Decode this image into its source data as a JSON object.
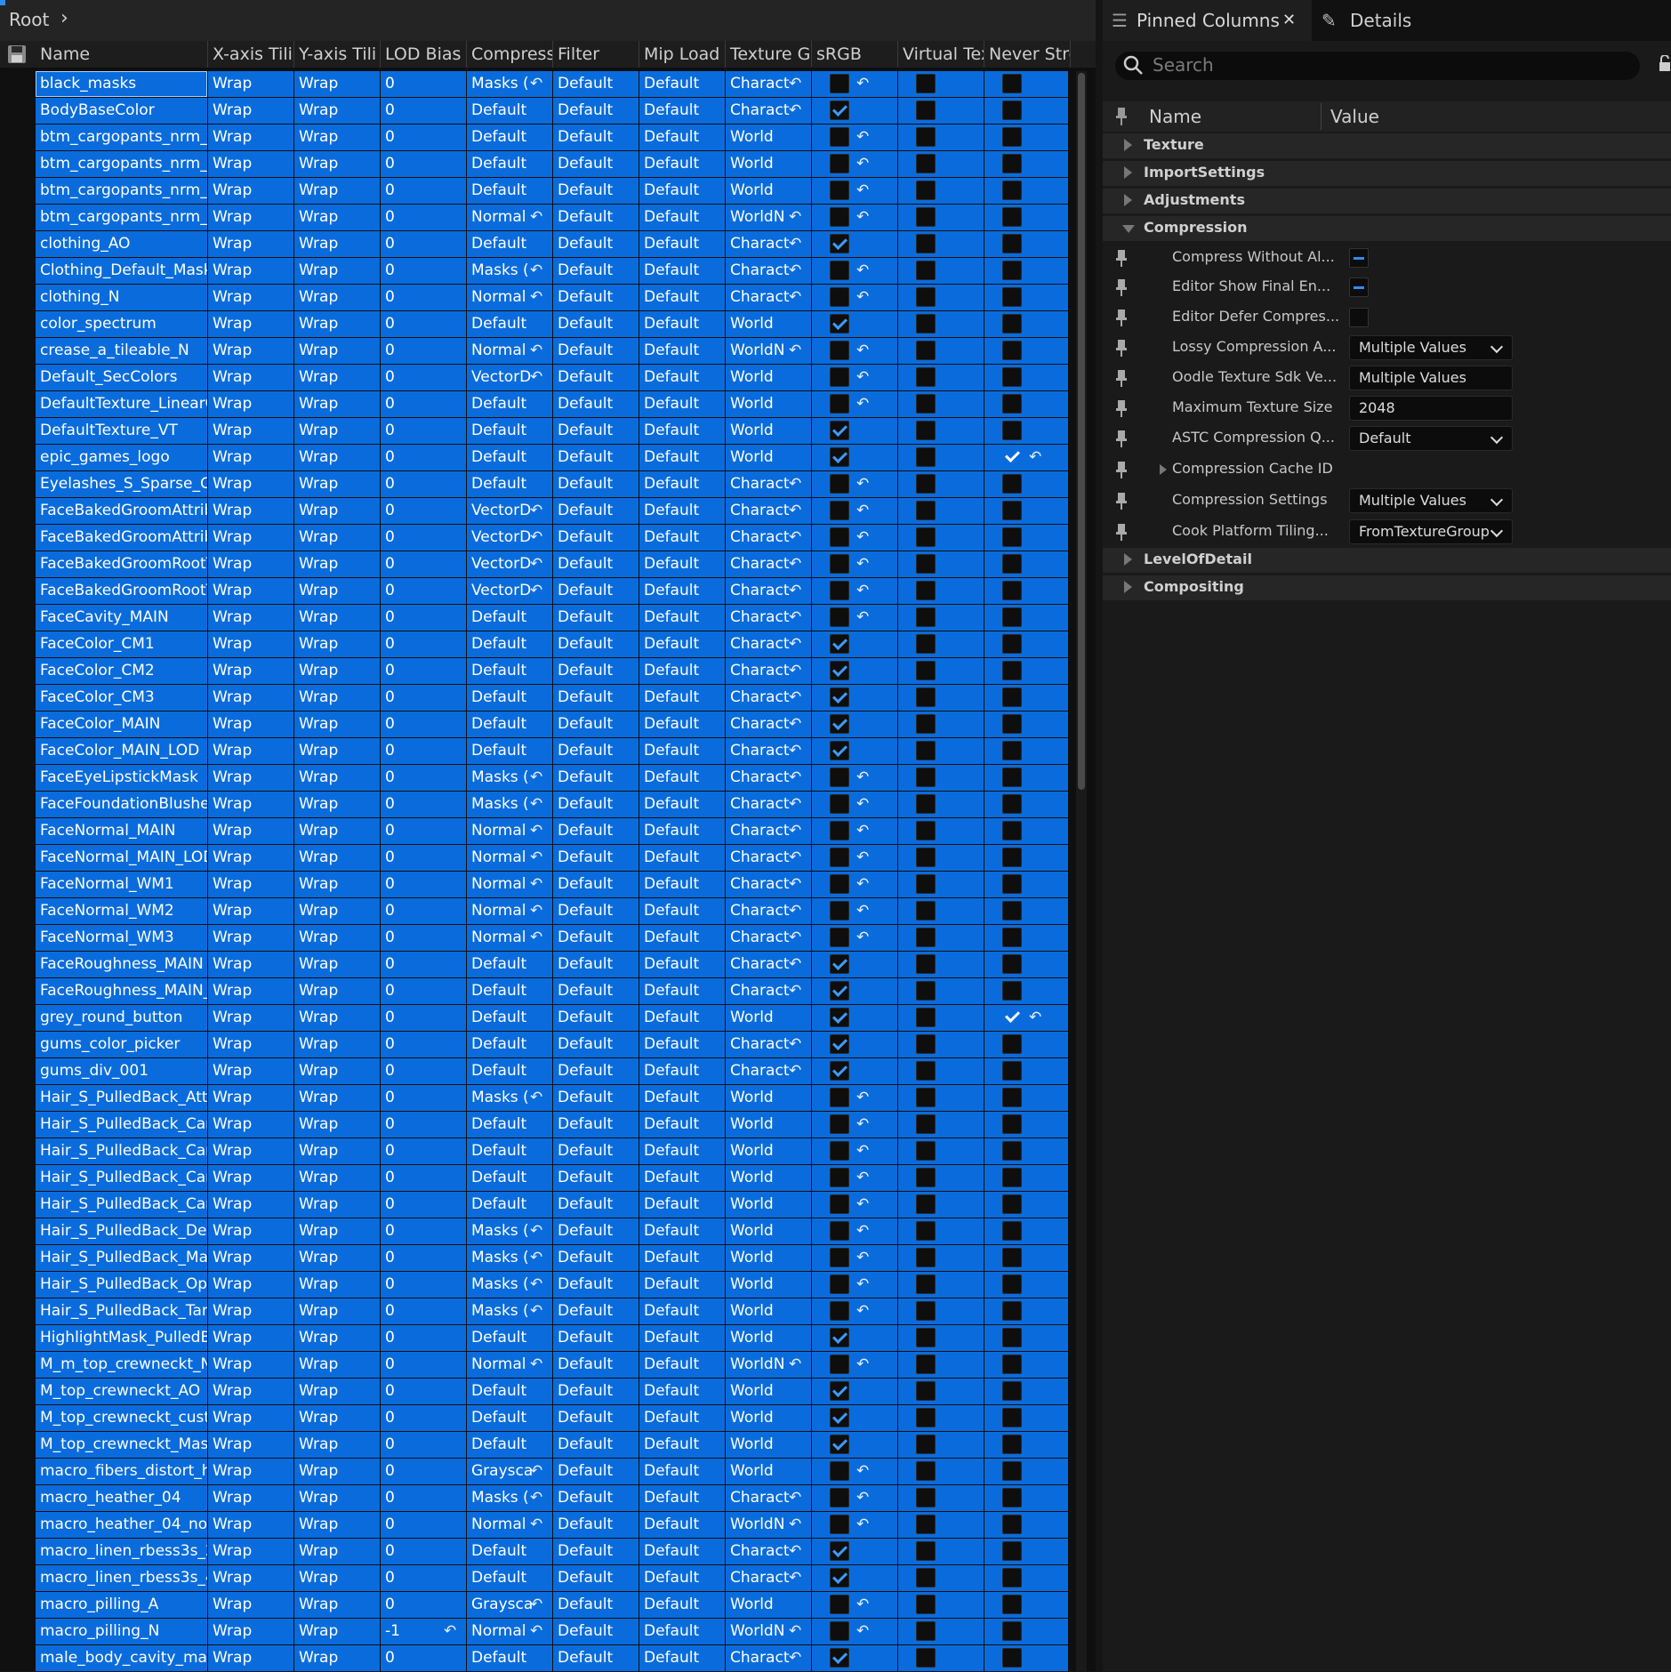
{
  "breadcrumb": {
    "root": "Root"
  },
  "columns": [
    "Name",
    "X-axis Tili",
    "Y-axis Tili",
    "LOD Bias",
    "Compress",
    "Filter",
    "Mip Load (",
    "Texture Gr",
    "sRGB",
    "Virtual Tex",
    "Never Stre"
  ],
  "rows": [
    [
      "black_masks",
      "Wrap",
      "Wrap",
      "0",
      "Masks (",
      "Default",
      "Default",
      "Charact",
      0,
      1,
      1,
      0,
      0
    ],
    [
      "BodyBaseColor",
      "Wrap",
      "Wrap",
      "0",
      "Default",
      "Default",
      "Default",
      "Charact",
      1,
      0,
      1,
      0,
      0
    ],
    [
      "btm_cargopants_nrm_A",
      "Wrap",
      "Wrap",
      "0",
      "Default",
      "Default",
      "Default",
      "World",
      0,
      1,
      0,
      0,
      0
    ],
    [
      "btm_cargopants_nrm_c",
      "Wrap",
      "Wrap",
      "0",
      "Default",
      "Default",
      "Default",
      "World",
      0,
      1,
      0,
      0,
      0
    ],
    [
      "btm_cargopants_nrm_N",
      "Wrap",
      "Wrap",
      "0",
      "Default",
      "Default",
      "Default",
      "World",
      0,
      1,
      0,
      0,
      0
    ],
    [
      "btm_cargopants_nrm_N",
      "Wrap",
      "Wrap",
      "0",
      "Normal",
      "Default",
      "Default",
      "WorldN",
      0,
      1,
      1,
      0,
      0
    ],
    [
      "clothing_AO",
      "Wrap",
      "Wrap",
      "0",
      "Default",
      "Default",
      "Default",
      "Charact",
      1,
      0,
      1,
      0,
      0
    ],
    [
      "Clothing_Default_Mask",
      "Wrap",
      "Wrap",
      "0",
      "Masks (",
      "Default",
      "Default",
      "Charact",
      0,
      1,
      1,
      0,
      0
    ],
    [
      "clothing_N",
      "Wrap",
      "Wrap",
      "0",
      "Normal",
      "Default",
      "Default",
      "Charact",
      0,
      1,
      1,
      0,
      0
    ],
    [
      "color_spectrum",
      "Wrap",
      "Wrap",
      "0",
      "Default",
      "Default",
      "Default",
      "World",
      1,
      0,
      0,
      0,
      0
    ],
    [
      "crease_a_tileable_N",
      "Wrap",
      "Wrap",
      "0",
      "Normal",
      "Default",
      "Default",
      "WorldN",
      0,
      1,
      1,
      0,
      0
    ],
    [
      "Default_SecColors",
      "Wrap",
      "Wrap",
      "0",
      "VectorD",
      "Default",
      "Default",
      "World",
      0,
      1,
      0,
      0,
      0
    ],
    [
      "DefaultTexture_LinearC",
      "Wrap",
      "Wrap",
      "0",
      "Default",
      "Default",
      "Default",
      "World",
      0,
      1,
      0,
      0,
      0
    ],
    [
      "DefaultTexture_VT",
      "Wrap",
      "Wrap",
      "0",
      "Default",
      "Default",
      "Default",
      "World",
      1,
      0,
      0,
      0,
      0
    ],
    [
      "epic_games_logo",
      "Wrap",
      "Wrap",
      "0",
      "Default",
      "Default",
      "Default",
      "World",
      1,
      0,
      0,
      1,
      1
    ],
    [
      "Eyelashes_S_Sparse_Co",
      "Wrap",
      "Wrap",
      "0",
      "Default",
      "Default",
      "Default",
      "Charact",
      0,
      1,
      1,
      0,
      0
    ],
    [
      "FaceBakedGroomAttribu",
      "Wrap",
      "Wrap",
      "0",
      "VectorD",
      "Default",
      "Default",
      "Charact",
      0,
      1,
      1,
      0,
      0
    ],
    [
      "FaceBakedGroomAttribu",
      "Wrap",
      "Wrap",
      "0",
      "VectorD",
      "Default",
      "Default",
      "Charact",
      0,
      1,
      1,
      0,
      0
    ],
    [
      "FaceBakedGroomRootT",
      "Wrap",
      "Wrap",
      "0",
      "VectorD",
      "Default",
      "Default",
      "Charact",
      0,
      1,
      1,
      0,
      0
    ],
    [
      "FaceBakedGroomRootT",
      "Wrap",
      "Wrap",
      "0",
      "VectorD",
      "Default",
      "Default",
      "Charact",
      0,
      1,
      1,
      0,
      0
    ],
    [
      "FaceCavity_MAIN",
      "Wrap",
      "Wrap",
      "0",
      "Default",
      "Default",
      "Default",
      "Charact",
      0,
      1,
      1,
      0,
      0
    ],
    [
      "FaceColor_CM1",
      "Wrap",
      "Wrap",
      "0",
      "Default",
      "Default",
      "Default",
      "Charact",
      1,
      0,
      1,
      0,
      0
    ],
    [
      "FaceColor_CM2",
      "Wrap",
      "Wrap",
      "0",
      "Default",
      "Default",
      "Default",
      "Charact",
      1,
      0,
      1,
      0,
      0
    ],
    [
      "FaceColor_CM3",
      "Wrap",
      "Wrap",
      "0",
      "Default",
      "Default",
      "Default",
      "Charact",
      1,
      0,
      1,
      0,
      0
    ],
    [
      "FaceColor_MAIN",
      "Wrap",
      "Wrap",
      "0",
      "Default",
      "Default",
      "Default",
      "Charact",
      1,
      0,
      1,
      0,
      0
    ],
    [
      "FaceColor_MAIN_LOD",
      "Wrap",
      "Wrap",
      "0",
      "Default",
      "Default",
      "Default",
      "Charact",
      1,
      0,
      1,
      0,
      0
    ],
    [
      "FaceEyeLipstickMask",
      "Wrap",
      "Wrap",
      "0",
      "Masks (",
      "Default",
      "Default",
      "Charact",
      0,
      1,
      1,
      0,
      0
    ],
    [
      "FaceFoundationBlusher",
      "Wrap",
      "Wrap",
      "0",
      "Masks (",
      "Default",
      "Default",
      "Charact",
      0,
      1,
      1,
      0,
      0
    ],
    [
      "FaceNormal_MAIN",
      "Wrap",
      "Wrap",
      "0",
      "Normal",
      "Default",
      "Default",
      "Charact",
      0,
      1,
      1,
      0,
      0
    ],
    [
      "FaceNormal_MAIN_LOD",
      "Wrap",
      "Wrap",
      "0",
      "Normal",
      "Default",
      "Default",
      "Charact",
      0,
      1,
      1,
      0,
      0
    ],
    [
      "FaceNormal_WM1",
      "Wrap",
      "Wrap",
      "0",
      "Normal",
      "Default",
      "Default",
      "Charact",
      0,
      1,
      1,
      0,
      0
    ],
    [
      "FaceNormal_WM2",
      "Wrap",
      "Wrap",
      "0",
      "Normal",
      "Default",
      "Default",
      "Charact",
      0,
      1,
      1,
      0,
      0
    ],
    [
      "FaceNormal_WM3",
      "Wrap",
      "Wrap",
      "0",
      "Normal",
      "Default",
      "Default",
      "Charact",
      0,
      1,
      1,
      0,
      0
    ],
    [
      "FaceRoughness_MAIN",
      "Wrap",
      "Wrap",
      "0",
      "Default",
      "Default",
      "Default",
      "Charact",
      1,
      0,
      1,
      0,
      0
    ],
    [
      "FaceRoughness_MAIN_",
      "Wrap",
      "Wrap",
      "0",
      "Default",
      "Default",
      "Default",
      "Charact",
      1,
      0,
      1,
      0,
      0
    ],
    [
      "grey_round_button",
      "Wrap",
      "Wrap",
      "0",
      "Default",
      "Default",
      "Default",
      "World",
      1,
      0,
      0,
      1,
      1
    ],
    [
      "gums_color_picker",
      "Wrap",
      "Wrap",
      "0",
      "Default",
      "Default",
      "Default",
      "Charact",
      1,
      0,
      1,
      0,
      0
    ],
    [
      "gums_div_001",
      "Wrap",
      "Wrap",
      "0",
      "Default",
      "Default",
      "Default",
      "Charact",
      1,
      0,
      1,
      0,
      0
    ],
    [
      "Hair_S_PulledBack_Attr",
      "Wrap",
      "Wrap",
      "0",
      "Masks (",
      "Default",
      "Default",
      "World",
      0,
      1,
      0,
      0,
      0
    ],
    [
      "Hair_S_PulledBack_Car",
      "Wrap",
      "Wrap",
      "0",
      "Default",
      "Default",
      "Default",
      "World",
      0,
      1,
      0,
      0,
      0
    ],
    [
      "Hair_S_PulledBack_Car",
      "Wrap",
      "Wrap",
      "0",
      "Default",
      "Default",
      "Default",
      "World",
      0,
      1,
      0,
      0,
      0
    ],
    [
      "Hair_S_PulledBack_Car",
      "Wrap",
      "Wrap",
      "0",
      "Default",
      "Default",
      "Default",
      "World",
      0,
      1,
      0,
      0,
      0
    ],
    [
      "Hair_S_PulledBack_Car",
      "Wrap",
      "Wrap",
      "0",
      "Default",
      "Default",
      "Default",
      "World",
      0,
      1,
      0,
      0,
      0
    ],
    [
      "Hair_S_PulledBack_Dep",
      "Wrap",
      "Wrap",
      "0",
      "Masks (",
      "Default",
      "Default",
      "World",
      0,
      1,
      0,
      0,
      0
    ],
    [
      "Hair_S_PulledBack_Mat",
      "Wrap",
      "Wrap",
      "0",
      "Masks (",
      "Default",
      "Default",
      "World",
      0,
      1,
      0,
      0,
      0
    ],
    [
      "Hair_S_PulledBack_Opa",
      "Wrap",
      "Wrap",
      "0",
      "Masks (",
      "Default",
      "Default",
      "World",
      0,
      1,
      0,
      0,
      0
    ],
    [
      "Hair_S_PulledBack_Tan",
      "Wrap",
      "Wrap",
      "0",
      "Masks (",
      "Default",
      "Default",
      "World",
      0,
      1,
      0,
      0,
      0
    ],
    [
      "HighlightMask_PulledB",
      "Wrap",
      "Wrap",
      "0",
      "Default",
      "Default",
      "Default",
      "World",
      1,
      0,
      0,
      0,
      0
    ],
    [
      "M_m_top_crewneckt_N",
      "Wrap",
      "Wrap",
      "0",
      "Normal",
      "Default",
      "Default",
      "WorldN",
      0,
      1,
      1,
      0,
      0
    ],
    [
      "M_top_crewneckt_AO",
      "Wrap",
      "Wrap",
      "0",
      "Default",
      "Default",
      "Default",
      "World",
      1,
      0,
      0,
      0,
      0
    ],
    [
      "M_top_crewneckt_custo",
      "Wrap",
      "Wrap",
      "0",
      "Default",
      "Default",
      "Default",
      "World",
      1,
      0,
      0,
      0,
      0
    ],
    [
      "M_top_crewneckt_Mask",
      "Wrap",
      "Wrap",
      "0",
      "Default",
      "Default",
      "Default",
      "World",
      1,
      0,
      0,
      0,
      0
    ],
    [
      "macro_fibers_distort_h",
      "Wrap",
      "Wrap",
      "0",
      "Graysca",
      "Default",
      "Default",
      "World",
      0,
      1,
      0,
      0,
      0
    ],
    [
      "macro_heather_04",
      "Wrap",
      "Wrap",
      "0",
      "Masks (",
      "Default",
      "Default",
      "Charact",
      0,
      1,
      1,
      0,
      0
    ],
    [
      "macro_heather_04_norm",
      "Wrap",
      "Wrap",
      "0",
      "Normal",
      "Default",
      "Default",
      "WorldN",
      0,
      1,
      1,
      0,
      0
    ],
    [
      "macro_linen_rbess3s_2",
      "Wrap",
      "Wrap",
      "0",
      "Default",
      "Default",
      "Default",
      "Charact",
      1,
      0,
      1,
      0,
      0
    ],
    [
      "macro_linen_rbess3s_4",
      "Wrap",
      "Wrap",
      "0",
      "Default",
      "Default",
      "Default",
      "Charact",
      1,
      0,
      1,
      0,
      0
    ],
    [
      "macro_pilling_A",
      "Wrap",
      "Wrap",
      "0",
      "Graysca",
      "Default",
      "Default",
      "World",
      0,
      1,
      0,
      0,
      0
    ],
    [
      "macro_pilling_N",
      "Wrap",
      "Wrap",
      "-1",
      "Normal",
      "Default",
      "Default",
      "WorldN",
      0,
      1,
      1,
      0,
      0
    ],
    [
      "male_body_cavity_map",
      "Wrap",
      "Wrap",
      "0",
      "Default",
      "Default",
      "Default",
      "Charact",
      1,
      0,
      1,
      0,
      0
    ]
  ],
  "right": {
    "tab_pinned": "Pinned Columns",
    "tab_details": "Details",
    "search_placeholder": "Search",
    "col_name": "Name",
    "col_value": "Value",
    "categories_top": [
      "Texture",
      "ImportSettings",
      "Adjustments"
    ],
    "compression": "Compression",
    "props": [
      {
        "label": "Compress Without Al...",
        "kind": "ind"
      },
      {
        "label": "Editor Show Final En...",
        "kind": "ind"
      },
      {
        "label": "Editor Defer Compres...",
        "kind": "empty"
      },
      {
        "label": "Lossy Compression A...",
        "kind": "dropdown",
        "value": "Multiple Values"
      },
      {
        "label": "Oodle Texture Sdk Ve...",
        "kind": "field",
        "value": "Multiple Values"
      },
      {
        "label": "Maximum Texture Size",
        "kind": "field",
        "value": "2048"
      },
      {
        "label": "ASTC Compression Q...",
        "kind": "dropdown",
        "value": "Default"
      },
      {
        "label": "Compression Cache ID",
        "kind": "sub"
      },
      {
        "label": "Compression Settings",
        "kind": "dropdown",
        "value": "Multiple Values"
      },
      {
        "label": "Cook Platform Tiling...",
        "kind": "dropdown",
        "value": "FromTextureGroup"
      }
    ],
    "categories_bottom": [
      "LevelOfDetail",
      "Compositing"
    ]
  },
  "colors": {
    "selection": "#0a6cdc",
    "accent": "#2f8ef0"
  }
}
